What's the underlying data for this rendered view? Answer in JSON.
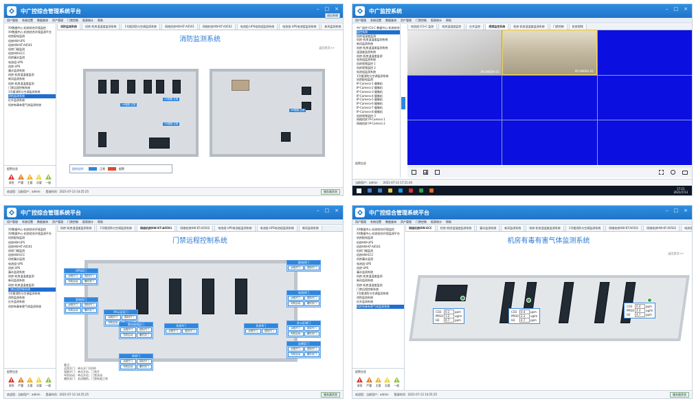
{
  "app": {
    "title": "中广控综合管理系统平台",
    "monitor_title": "中广监控系统",
    "user_button": "退出系统",
    "win_controls": [
      "–",
      "□",
      "×"
    ]
  },
  "menu": [
    "用户管理",
    "系统设置",
    "数据查询",
    "资产管理",
    "门禁控制",
    "报表统计",
    "帮助"
  ],
  "windows": [
    {
      "tabs": [
        "消防监测系统",
        "机房-机房温湿度监测系统",
        "1号楼消防与空调监测系统",
        "网络机房HW-KT-A0501",
        "网络机房HW-KT-A0502",
        "电池组-UPS电池组监测系统",
        "电池组-UPS电池组监测系统",
        "新风监测系统"
      ],
      "active_tab": 0,
      "content_title": "消防监测系统",
      "back_link": "返回首页>>",
      "tree": [
        "XX数据中心-机房综合环境监控",
        "XX数据中心-机房综合环境监测平台",
        "机房配电监测",
        "机房HW-UPS",
        "机房HW-KT-A0501",
        "机房门磁监测",
        "机房HW-ECC",
        "机房漏水监测",
        "电池组-UPS",
        "机房-UPS",
        "漏水监测系统",
        "机房-机房温湿度监测",
        "新风监测系统",
        "机房-机房温湿度监测",
        "门禁远程控制系统",
        "1号楼消防与空调监测系统",
        "消防监测系统",
        "红外监测系统",
        "机房有毒有害气体监测系统"
      ],
      "selected_tree": 16,
      "alarm_header": "报警信息",
      "alarm_labels": [
        "紧急",
        "严重",
        "主要",
        "次要",
        "一般"
      ],
      "status_user": "欢迎您：当前用户：admin",
      "status_time": "登录时间：2021-07-13 14:25:25",
      "status_button": "服务器状态",
      "badges": [
        "1#烟感",
        "2#烟感",
        "3#烟感",
        "4#烟感"
      ],
      "badge_states": [
        "正常",
        "正常",
        "正常",
        "正常"
      ],
      "legend_label": "图例说明：",
      "legend_items": [
        "正常",
        "报警"
      ]
    },
    {
      "title": "中广监控系统",
      "tree": [
        "中广监控 ICS-C 数据中心-机房综合",
        "监控系统",
        "机房温湿度监测",
        "机房-机房温湿度监测系统",
        "新风监测系统",
        "机房-机房温湿度监测系统",
        "温湿度监测系统",
        "机房-机房温湿度监测",
        "电池组监测系统",
        "机房视频监控 1",
        "机房视频监控 2",
        "电池组监测系统",
        "1号楼消防与空调监测系统",
        "机房配电监测",
        "IP-Camera-1 摄像机",
        "IP-Camera-2 摄像机",
        "IP-Camera-3 摄像机",
        "IP-Camera-4 摄像机",
        "IP-Camera-5 摄像机",
        "IP-Camera-6 摄像机",
        "IP-Camera-7 摄像机",
        "IP-Camera-8 摄像机",
        "机房视频监控 3",
        "网络机房 IP-Camera 1",
        "网络机房 IP-Camera 2"
      ],
      "selected_tree": 1,
      "tabs": [
        "电池组 ICS-C 监控",
        "机房温湿度监控",
        "红外监控",
        "视频监控系统",
        "机房-机房温湿度监测系统",
        "门禁控制",
        "机房视频"
      ],
      "active_tab": 3,
      "cam_labels": [
        "IPCAMERA 01",
        "IPCAMERA 02"
      ],
      "alarm_header": "报警信息",
      "status_user": "当前用户：admin",
      "status_time": "2021-07-13 17:21:44",
      "clock": "17:21",
      "date": "2021/7/13"
    },
    {
      "tabs": [
        "机房-机房温湿度监测系统",
        "1号楼消防与空调监测系统",
        "网络机房HW-KT-A0501",
        "网络机房HW-KT-A0502",
        "电池组-UPS电池组监测系统",
        "电池组-UPS电池组监测系统",
        "新风监测系统"
      ],
      "active_tab": 2,
      "content_title": "门禁远程控制系统",
      "tree": [
        "XX数据中心-机房综合环境监控",
        "XX数据中心-机房综合环境监测平台",
        "机房配电监测",
        "机房HW-UPS",
        "机房HW-KT-A0501",
        "机房门磁监测",
        "机房HW-ECC",
        "机房漏水监测",
        "电池组-UPS",
        "机房-UPS",
        "漏水监测系统",
        "机房-机房温湿度监测",
        "新风监测系统",
        "机房-机房温湿度监测",
        "门禁远程控制系统",
        "1号楼消防与空调监测系统",
        "消防监测系统",
        "红外监测系统",
        "机房有毒有害气体监测系统"
      ],
      "selected_tree": 14,
      "alarm_header": "报警信息",
      "alarm_labels": [
        "紧急",
        "严重",
        "主要",
        "次要",
        "一般"
      ],
      "status_user": "欢迎您：当前用户：admin",
      "status_time": "登录时间：2021-07-13 14:25:25",
      "status_button": "服务器状态",
      "doors": [
        {
          "name": "UPS间门",
          "buttons": [
            "远程开门",
            "强制开门",
            "布防启动",
            "撤防关门"
          ]
        },
        {
          "name": "发电间门",
          "buttons": [
            "远程开门",
            "强制开门",
            "布防启动",
            "撤防关门"
          ]
        },
        {
          "name": "RA认证区门",
          "buttons": [
            "远程开门",
            "强制开门",
            "布防启动",
            "撤防关门"
          ]
        },
        {
          "name": "钢化玻璃区门",
          "buttons": [
            "远程开门",
            "强制开门",
            "布防启动",
            "撤防关门"
          ]
        },
        {
          "name": "机房A门",
          "buttons": [
            "远程开门",
            "强制开门"
          ]
        },
        {
          "name": "机房B门",
          "buttons": [
            "远程开门",
            "强制开门"
          ]
        },
        {
          "name": "库房门",
          "buttons": [
            "远程开门",
            "强制开门",
            "布防启动",
            "撤防关门"
          ]
        },
        {
          "name": "配电间门",
          "buttons": [
            "远程开门",
            "强制开门"
          ]
        },
        {
          "name": "电池间门",
          "buttons": [
            "远程开门",
            "强制开门",
            "布防启动",
            "撤防关门"
          ]
        },
        {
          "name": "办公区域门",
          "buttons": [
            "远程开门",
            "强制开门",
            "布防启动",
            "撤防关门"
          ]
        },
        {
          "name": "走廊区门",
          "buttons": [
            "远程开门",
            "强制开门",
            "布防启动",
            "撤防关门"
          ]
        }
      ],
      "note_title": "备注：",
      "notes": [
        "远程开门：单击开门1秒钟",
        "强制开门：单击开启，门常开",
        "布防启动：单击开启，门禁关闭",
        "撤防关门：关闭撤防，门禁恢复正常"
      ]
    },
    {
      "tabs": [
        "网络机房HW-ECC",
        "机房-机房温湿度监测系统",
        "漏水监测系统",
        "新风监测系统",
        "机房-机房温湿度监测系统",
        "1号楼消防与空调监测系统",
        "网络机房HW-KT-A0501",
        "网络机房HW-KT-A0502",
        "电池组-UPS电池组监测系统"
      ],
      "active_tab": 0,
      "content_title": "机房有毒有害气体监测系统",
      "back_link": "返回首页>>",
      "tree": [
        "XX数据中心-机房综合环境监控",
        "XX数据中心-机房综合环境监测平台",
        "机房配电监测",
        "机房HW-UPS",
        "机房HW-KT-A0501",
        "机房门磁监测",
        "机房HW-ECC",
        "机房漏水监测",
        "电池组-UPS",
        "机房-UPS",
        "漏水监测系统",
        "机房-机房温湿度监测",
        "新风监测系统",
        "机房-机房温湿度监测",
        "门禁远程控制系统",
        "1号楼消防与空调监测系统",
        "消防监测系统",
        "红外监测系统",
        "机房有毒有害气体监测系统"
      ],
      "selected_tree": 18,
      "alarm_header": "报警信息",
      "alarm_labels": [
        "紧急",
        "严重",
        "主要",
        "次要",
        "一般"
      ],
      "status_user": "欢迎您：当前用户：admin",
      "status_time": "登录时间：2021-07-13 14:25:25",
      "status_button": "服务器状态",
      "gas_sensors": [
        {
          "CO2": "0.1",
          "PM10": "1.2",
          "H2": "6.7",
          "units": [
            "ppm",
            "ug/m",
            "ppm"
          ]
        },
        {
          "CO2": "0.4",
          "PM10": "2.3",
          "H2": "4.7",
          "units": [
            "ppm",
            "ug/m",
            "ppm"
          ]
        },
        {
          "CO2": "0.4",
          "PM10": "2.3",
          "H2": "4.7",
          "units": [
            "ppm",
            "ug/m",
            "ppm"
          ]
        }
      ],
      "gas_keys": [
        "CO2",
        "PM10",
        "H2"
      ]
    }
  ],
  "colors": {
    "title_blue": "#1f74c8",
    "accent": "#2e86de",
    "video_blue": "#0b10e0",
    "alarm_colors": [
      "#d9322a",
      "#e8781e",
      "#f0b21c",
      "#f0d52a",
      "#8fc53a"
    ]
  }
}
